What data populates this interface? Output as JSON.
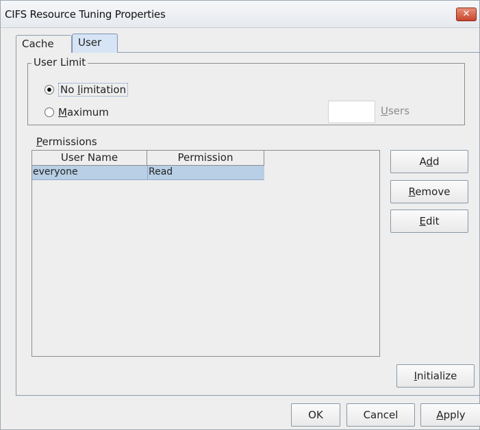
{
  "window": {
    "title": "CIFS Resource Tuning Properties",
    "close_glyph": "✕"
  },
  "tabs": [
    {
      "label": "Cache",
      "active": false
    },
    {
      "label": "User",
      "active": true
    }
  ],
  "user_limit": {
    "legend": "User Limit",
    "no_limitation": {
      "prefix": "No ",
      "mnemonic": "l",
      "rest": "imitation",
      "checked": true
    },
    "maximum": {
      "mnemonic": "M",
      "rest": "aximum",
      "checked": false
    },
    "max_value": "",
    "users_label": {
      "mnemonic": "U",
      "rest": "sers"
    }
  },
  "permissions": {
    "label": {
      "mnemonic": "P",
      "rest": "ermissions"
    },
    "columns": [
      "User Name",
      "Permission"
    ],
    "rows": [
      {
        "user": "everyone",
        "permission": "Read"
      }
    ]
  },
  "side_buttons": {
    "add": {
      "prefix": "A",
      "mnemonic": "d",
      "rest": "d"
    },
    "remove": {
      "mnemonic": "R",
      "rest": "emove"
    },
    "edit": {
      "mnemonic": "E",
      "rest": "dit"
    },
    "initialize": {
      "mnemonic": "I",
      "rest": "nitialize"
    }
  },
  "footer": {
    "ok": "OK",
    "cancel": "Cancel",
    "apply": {
      "mnemonic": "A",
      "rest": "pply"
    }
  }
}
